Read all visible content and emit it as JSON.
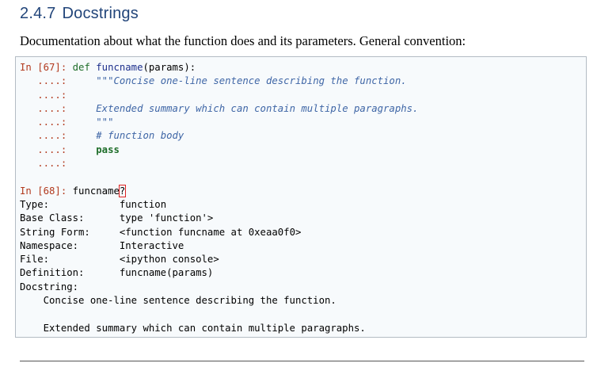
{
  "section": {
    "number": "2.4.7",
    "title": "Docstrings",
    "intro": "Documentation about what the function does and its parameters. General convention:"
  },
  "code": {
    "cell67_prompt": "In [67]:",
    "def_kw": "def",
    "func_name": "funcname",
    "params": "(params):",
    "cont_prompt": "   ....:",
    "docstring_line1": "\"\"\"Concise one-line sentence describing the function.",
    "docstring_line3": "Extended summary which can contain multiple paragraphs.",
    "docstring_close": "\"\"\"",
    "comment": "# function body",
    "pass_kw": "pass",
    "cell68_prompt": "In [68]:",
    "cell68_input": "funcname",
    "cell68_qmark": "?",
    "info": [
      {
        "label": "Type:",
        "value": "function"
      },
      {
        "label": "Base Class:",
        "value": "type 'function'>"
      },
      {
        "label": "String Form:",
        "value": "<function funcname at 0xeaa0f0>"
      },
      {
        "label": "Namespace:",
        "value": "Interactive"
      },
      {
        "label": "File:",
        "value": "<ipython console>"
      },
      {
        "label": "Definition:",
        "value": "funcname(params)"
      }
    ],
    "docstring_label": "Docstring:",
    "docstring_out1": "    Concise one-line sentence describing the function.",
    "docstring_out2": "    Extended summary which can contain multiple paragraphs."
  }
}
